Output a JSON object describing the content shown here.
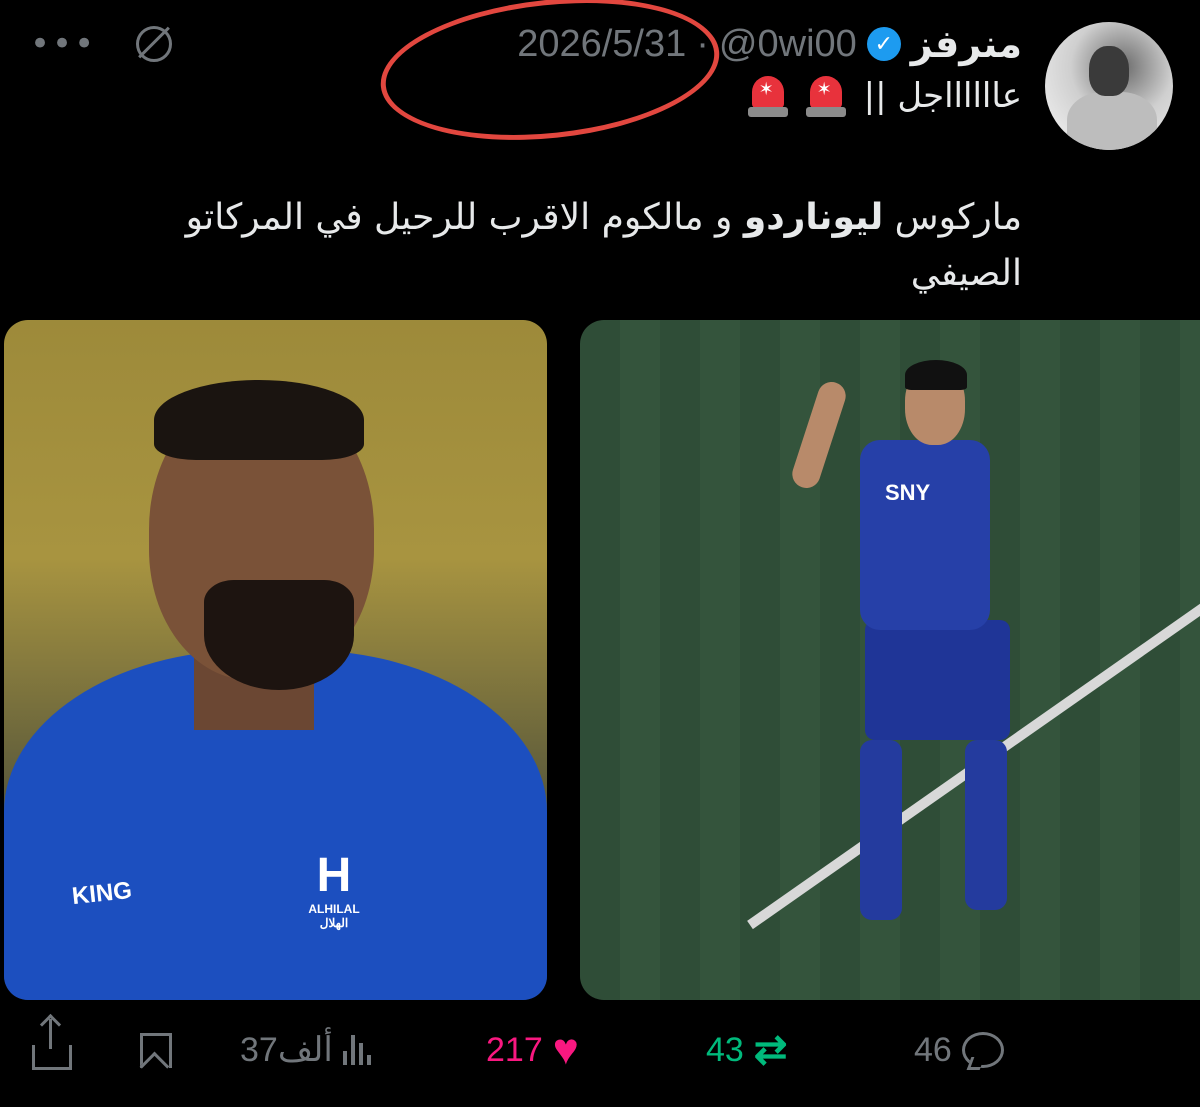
{
  "author": {
    "display_name": "منرفز",
    "handle": "@0wi00",
    "separator": "·",
    "date": "2026/5/31",
    "verified": true
  },
  "subtitle": {
    "text": "عااااااجل ||",
    "icons": [
      "siren-icon",
      "siren-icon"
    ]
  },
  "tweet": {
    "text_part1": "ماركوس ",
    "text_bold": "ليوناردو",
    "text_part2": " و مالكوم الاقرب للرحيل في المركاتو الصيفي"
  },
  "media": [
    {
      "kind": "photo",
      "jacket_text": "KING",
      "logo_text": "ALHILAL الهلال"
    },
    {
      "kind": "photo",
      "sponsor_text": "SNY"
    }
  ],
  "actions": {
    "replies": "46",
    "retweets": "43",
    "likes": "217",
    "views": "37ألف"
  },
  "colors": {
    "background": "#000000",
    "text": "#e7e9ea",
    "muted": "#71767b",
    "verified": "#1d9bf0",
    "retweet": "#00ba7c",
    "like": "#f91880",
    "annotation": "#e2473f"
  }
}
